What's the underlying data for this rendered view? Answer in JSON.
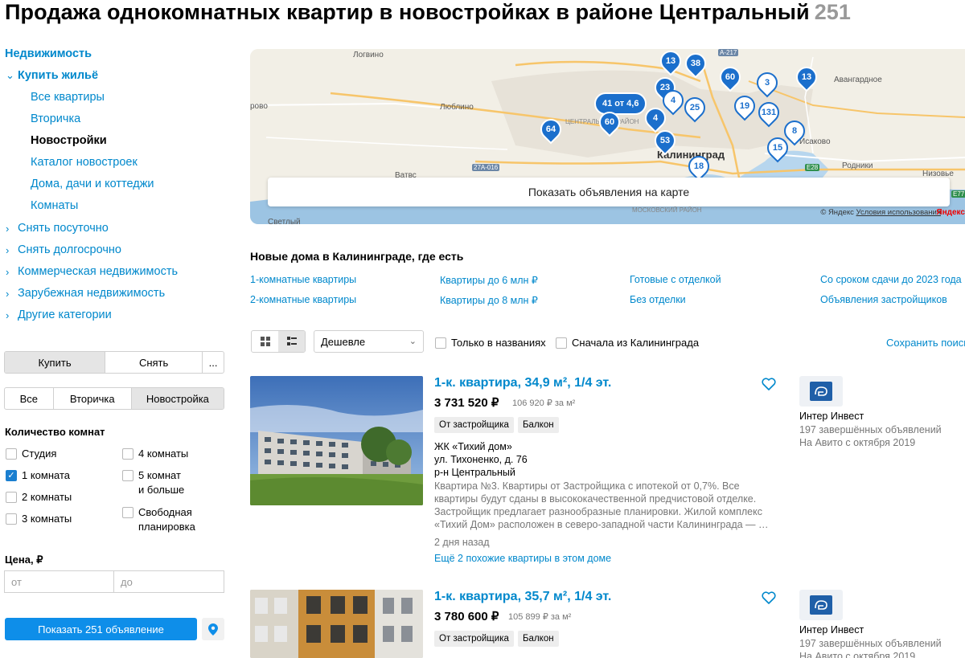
{
  "page": {
    "title": "Продажа однокомнатных квартир в новостройках в районе Центральный",
    "count": "251"
  },
  "sidebar": {
    "nav_header": "Недвижимость",
    "buy_section": "Купить жильё",
    "buy_items": [
      "Все квартиры",
      "Вторичка",
      "Новостройки",
      "Каталог новостроек",
      "Дома, дачи и коттеджи",
      "Комнаты"
    ],
    "active_item": "Новостройки",
    "other_sections": [
      "Снять посуточно",
      "Снять долгосрочно",
      "Коммерческая недвижимость",
      "Зарубежная недвижимость",
      "Другие категории"
    ],
    "deal_tabs": [
      "Купить",
      "Снять",
      "..."
    ],
    "deal_selected": "Купить",
    "market_tabs": [
      "Все",
      "Вторичка",
      "Новостройка"
    ],
    "market_selected": "Новостройка",
    "rooms_label": "Количество комнат",
    "rooms_left": [
      {
        "label": "Студия",
        "checked": false
      },
      {
        "label": "1 комната",
        "checked": true
      },
      {
        "label": "2 комнаты",
        "checked": false
      },
      {
        "label": "3 комнаты",
        "checked": false
      }
    ],
    "rooms_right": [
      {
        "label": "4 комнаты",
        "checked": false
      },
      {
        "label_line1": "5 комнат",
        "label_line2": "и больше",
        "checked": false
      },
      {
        "label_line1": "Свободная",
        "label_line2": "планировка",
        "checked": false
      }
    ],
    "price_label": "Цена, ₽",
    "price_from_placeholder": "от",
    "price_to_placeholder": "до",
    "show_button": "Показать 251 объявление"
  },
  "map": {
    "show_on_map": "Показать объявления на карте",
    "labels": [
      "Логвино",
      "Люблино",
      "Авангардное",
      "Исаково",
      "Родники",
      "Низовье",
      "Калининград"
    ],
    "partial_labels": [
      "рово",
      "Ватвс",
      "ЦЕНТРАЛЬНЫЙ РАЙОН",
      "МОСКОВСКИЙ РАЙОН",
      "Светлый"
    ],
    "roads": [
      "A-217",
      "27A-016",
      "E28",
      "E77"
    ],
    "copyright": "© Яндекс",
    "terms": "Условия использования",
    "provider": "Яндекс",
    "pins": [
      "13",
      "38",
      "60",
      "3",
      "13",
      "23",
      "41 от 4,6",
      "4",
      "25",
      "19",
      "131",
      "60",
      "64",
      "4",
      "8",
      "53",
      "15",
      "18"
    ]
  },
  "new_homes": {
    "title": "Новые дома в Калининграде, где есть",
    "links_row1": [
      "1-комнатные квартиры",
      "Квартиры до 6 млн ₽",
      "Готовые с отделкой",
      "Со сроком сдачи до 2023 года"
    ],
    "links_row2": [
      "2-комнатные квартиры",
      "Квартиры до 8 млн ₽",
      "Без отделки",
      "Объявления застройщиков"
    ]
  },
  "toolbar": {
    "sort_value": "Дешевле",
    "only_titles": "Только в названиях",
    "kaliningrad_first": "Сначала из Калининграда",
    "save_search": "Сохранить поиск"
  },
  "listings": [
    {
      "title": "1-к. квартира, 34,9 м², 1/4 эт.",
      "price": "3 731 520 ₽",
      "price_per_m": "106 920 ₽ за м²",
      "tags": [
        "От застройщика",
        "Балкон"
      ],
      "complex": "ЖК «Тихий дом»",
      "street": "ул. Тихоненко, д. 76",
      "district": "р-н Центральный",
      "description": "Квартира №3. Квартиры от Застройщика с ипотекой от 0,7%. Все квартиры будут сданы в высококачественной предчистовой отделке. Застройщик предлагает разнообразные планировки. Жилой комплекс «Тихий Дом» расположен в северо-западной части Калининграда — …",
      "date": "2 дня назад",
      "more": "Ещё 2 похожие квартиры в этом доме",
      "seller": "Интер Инвест",
      "seller_ads": "197 завершённых объявлений",
      "seller_since": "На Авито с октября 2019"
    },
    {
      "title": "1-к. квартира, 35,7 м², 1/4 эт.",
      "price": "3 780 600 ₽",
      "price_per_m": "105 899 ₽ за м²",
      "tags": [
        "От застройщика",
        "Балкон"
      ],
      "seller": "Интер Инвест",
      "seller_ads": "197 завершённых объявлений",
      "seller_since": "На Авито с октября 2019"
    }
  ],
  "colors": {
    "link": "#0088cc",
    "button": "#0e8ee9",
    "pin": "#1b6fcc"
  }
}
